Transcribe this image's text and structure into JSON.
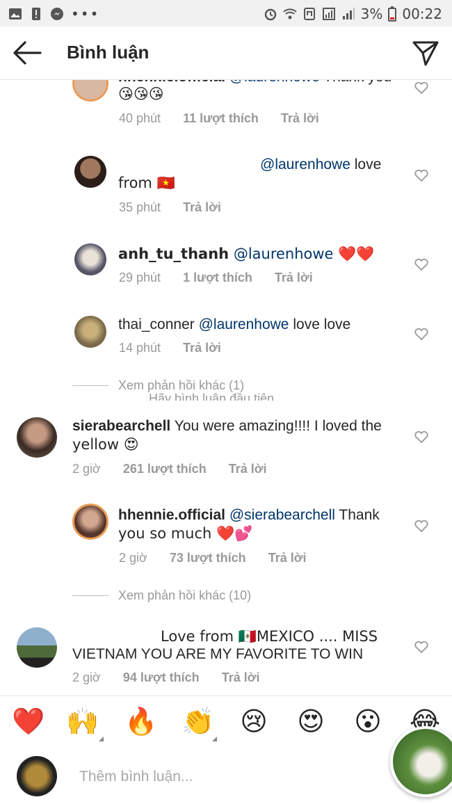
{
  "status_bar": {
    "battery": "3%",
    "time": "00:22"
  },
  "header": {
    "title": "Bình luận"
  },
  "comments": [
    {
      "username": "hhennie.official",
      "mention": "@laurenhowe",
      "text": "Thank you",
      "emojis": "😘😘😘",
      "time": "40 phút",
      "likes": "11 lượt thích",
      "reply": "Trả lời"
    },
    {
      "mention": "@laurenhowe",
      "text": "love",
      "text2": "from 🇻🇳",
      "time": "35 phút",
      "reply": "Trả lời"
    },
    {
      "username": "anh_tu_thanh",
      "mention": "@laurenhowe",
      "text": "❤️❤️",
      "time": "29 phút",
      "likes": "1 lượt thích",
      "reply": "Trả lời"
    },
    {
      "username": "thai_conner",
      "mention": "@laurenhowe",
      "text": "love love",
      "time": "14 phút",
      "reply": "Trả lời"
    },
    {
      "username": "sierabearchell",
      "text": "You were amazing!!!! I loved the",
      "text2": "yellow 😍",
      "time": "2 giờ",
      "likes": "261 lượt thích",
      "reply": "Trả lời"
    },
    {
      "username": "hhennie.official",
      "mention": "@sierabearchell",
      "text": "Thank",
      "text2": "you so much ❤️💕",
      "time": "2 giờ",
      "likes": "73 lượt thích",
      "reply": "Trả lời"
    },
    {
      "text": "Love from 🇲🇽MEXICO .... MISS",
      "text2": "VIETNAM YOU ARE MY FAVORITE TO WIN",
      "time": "2 giờ",
      "likes": "94 lượt thích",
      "reply": "Trả lời"
    }
  ],
  "view_more": [
    {
      "label": "Xem phản hồi khác (1)",
      "overlay": "Hãy bình luận đầu tiên"
    },
    {
      "label": "Xem phản hồi khác (10)"
    }
  ],
  "reactions": [
    "❤️",
    "🙌",
    "🔥",
    "👏",
    "😢",
    "😍",
    "😮",
    "😂"
  ],
  "composer": {
    "placeholder": "Thêm bình luận..."
  },
  "colors": {
    "mention": "#003569",
    "story_ring": "#e89d57",
    "meta": "#999999"
  }
}
